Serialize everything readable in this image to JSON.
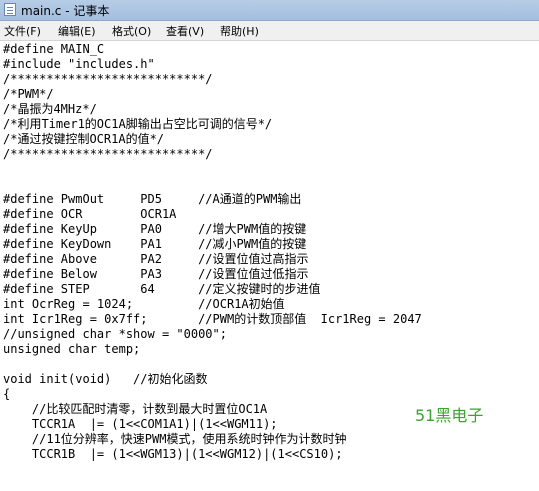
{
  "window": {
    "title": "main.c - 记事本"
  },
  "menu": {
    "items": [
      "文件(F)",
      "编辑(E)",
      "格式(O)",
      "查看(V)",
      "帮助(H)"
    ]
  },
  "editor": {
    "lines": [
      "#define MAIN_C",
      "#include \"includes.h\"",
      "/***************************/",
      "/*PWM*/",
      "/*晶振为4MHz*/",
      "/*利用Timer1的OC1A脚输出占空比可调的信号*/",
      "/*通过按键控制OCR1A的值*/",
      "/***************************/",
      "",
      "",
      "#define PwmOut     PD5     //A通道的PWM输出",
      "#define OCR        OCR1A",
      "#define KeyUp      PA0     //增大PWM值的按键",
      "#define KeyDown    PA1     //减小PWM值的按键",
      "#define Above      PA2     //设置位值过高指示",
      "#define Below      PA3     //设置位值过低指示",
      "#define STEP       64      //定义按键时的步进值",
      "int OcrReg = 1024;         //OCR1A初始值",
      "int Icr1Reg = 0x7ff;       //PWM的计数顶部值  Icr1Reg = 2047",
      "//unsigned char *show = \"0000\";",
      "unsigned char temp;",
      "",
      "void init(void)   //初始化函数",
      "{",
      "    //比较匹配时清零，计数到最大时置位OC1A",
      "    TCCR1A  |= (1<<COM1A1)|(1<<WGM11);",
      "    //11位分辨率，快速PWM模式，使用系统时钟作为计数时钟",
      "    TCCR1B  |= (1<<WGM13)|(1<<WGM12)|(1<<CS10);"
    ]
  },
  "watermark": {
    "text": "51黑电子"
  }
}
